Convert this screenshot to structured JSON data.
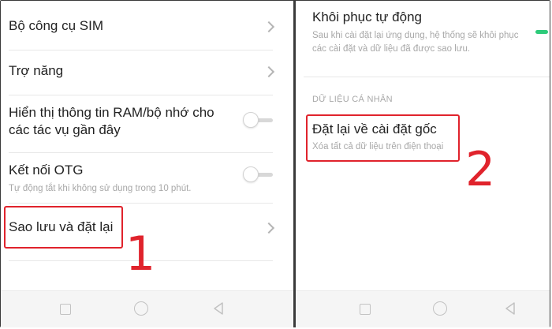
{
  "left_panel": {
    "items": [
      {
        "title": "Bộ công cụ SIM"
      },
      {
        "title": "Trợ năng"
      },
      {
        "title_line1": "Hiển thị thông tin RAM/bộ nhớ cho",
        "title_line2": "các tác vụ gần đây"
      },
      {
        "title": "Kết nối OTG",
        "subtitle": "Tự động tắt khi không sử dụng trong 10 phút."
      },
      {
        "title": "Sao lưu và đặt lại"
      }
    ],
    "step_number": "1"
  },
  "right_panel": {
    "auto_restore": {
      "title": "Khôi phục tự động",
      "subtitle": "Sau khi cài đặt lại ứng dụng, hệ thống sẽ khôi phục các cài đặt và dữ liệu đã được sao lưu."
    },
    "section_label": "DỮ LIỆU CÁ NHÂN",
    "factory_reset": {
      "title": "Đặt lại về cài đặt gốc",
      "subtitle": "Xóa tất cả dữ liệu trên điện thoại"
    },
    "step_number": "2"
  },
  "colors": {
    "highlight": "#e0232c",
    "toggle_on": "#2ecb7a",
    "text_primary": "#222222",
    "text_secondary": "#a8a8a8"
  },
  "icons": {
    "nav": [
      "recent-apps-icon",
      "home-icon",
      "back-icon"
    ],
    "row": [
      "chevron-right-icon",
      "toggle-switch-icon"
    ]
  }
}
